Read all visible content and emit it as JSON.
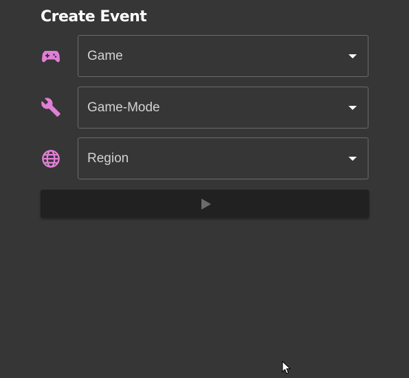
{
  "title": "Create Event",
  "accent_color": "#e07fd6",
  "fields": [
    {
      "icon": "gamepad-icon",
      "value": "Game"
    },
    {
      "icon": "wrench-icon",
      "value": "Game-Mode"
    },
    {
      "icon": "globe-icon",
      "value": "Region"
    }
  ],
  "submit": {
    "icon": "play-icon"
  }
}
